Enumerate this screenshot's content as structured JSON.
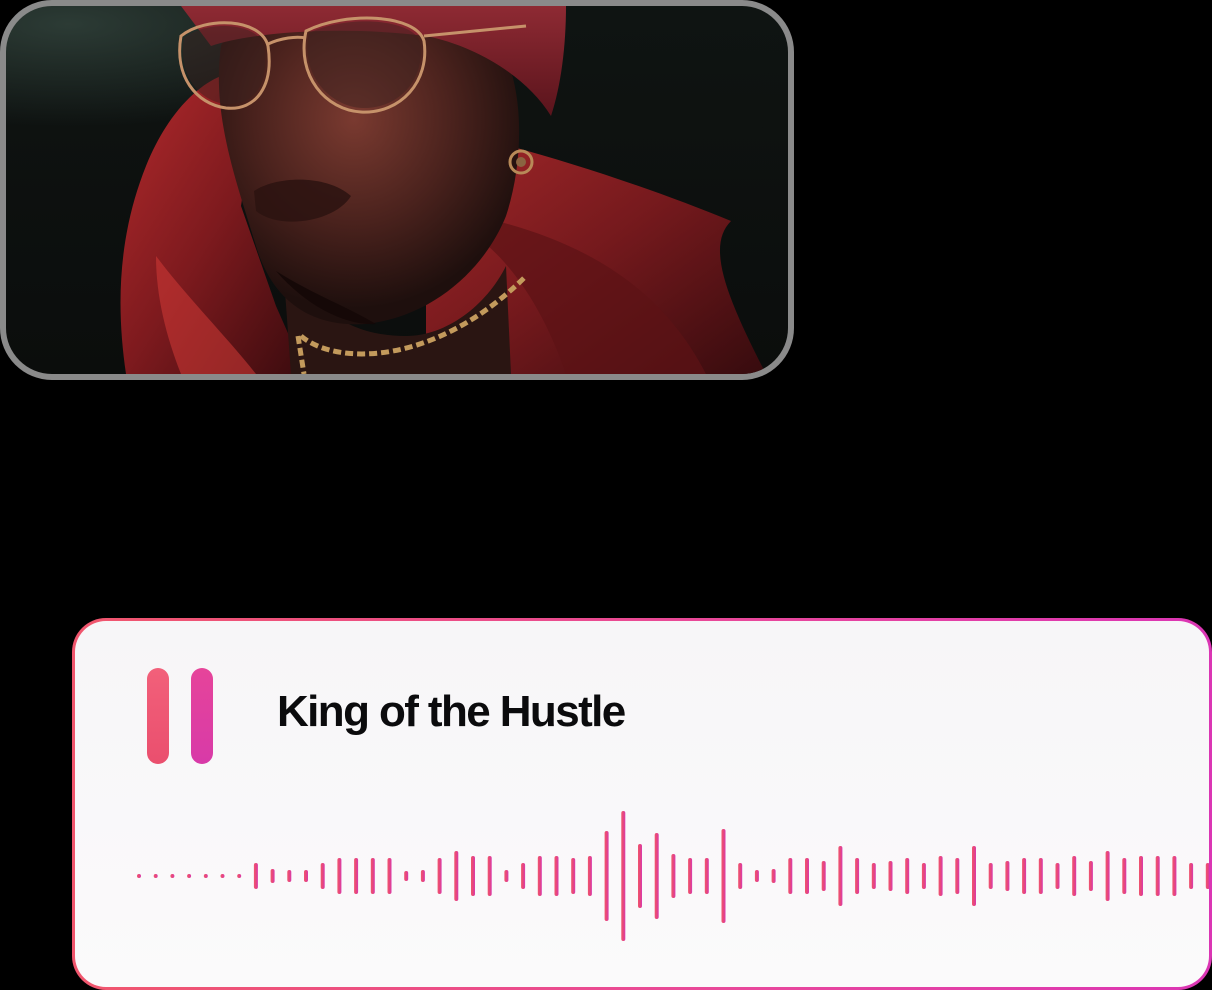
{
  "artwork": {
    "alt": "Album artwork: portrait of a man in red hood and glasses"
  },
  "player": {
    "track_title": "King of the Hustle",
    "state": "playing",
    "pause_icon": "pause-icon",
    "waveform_icon": "waveform",
    "colors": {
      "gradient_start": "#f0566d",
      "gradient_end": "#db35b4",
      "title_text": "#0b0b0d",
      "card_background": "#f8f7f9"
    }
  }
}
